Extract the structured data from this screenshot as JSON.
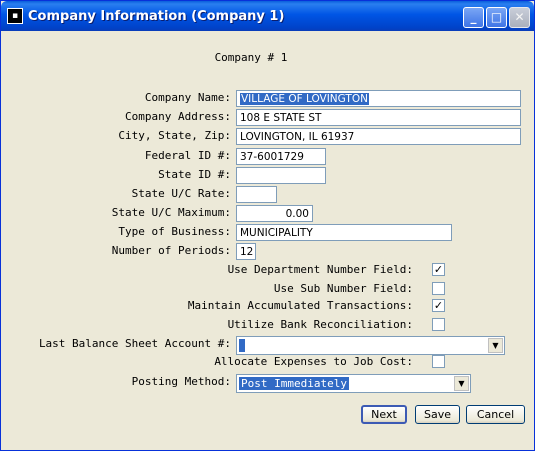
{
  "window": {
    "title": "Company Information (Company 1)",
    "app_icon": "app-icon",
    "controls": {
      "minimize": "_",
      "maximize": "□",
      "close": "✕"
    }
  },
  "form": {
    "heading": "Company # 1",
    "company_name": {
      "label": "Company Name:",
      "value": "VILLAGE OF LOVINGTON"
    },
    "company_address": {
      "label": "Company Address:",
      "value": "108 E STATE ST"
    },
    "city_state_zip": {
      "label": "City, State, Zip:",
      "value": "LOVINGTON, IL 61937"
    },
    "federal_id": {
      "label": "Federal ID #:",
      "value": "37-6001729"
    },
    "state_id": {
      "label": "State ID #:",
      "value": ""
    },
    "state_uc_rate": {
      "label": "State U/C Rate:",
      "value": ""
    },
    "state_uc_max": {
      "label": "State U/C Maximum:",
      "value": "0.00"
    },
    "type_of_business": {
      "label": "Type of Business:",
      "value": "MUNICIPALITY"
    },
    "number_of_periods": {
      "label": "Number of Periods:",
      "value": "12"
    },
    "use_department": {
      "label": "Use Department Number Field:",
      "checked": true
    },
    "use_sub_number": {
      "label": "Use Sub Number Field:",
      "checked": false
    },
    "maintain_accumulated": {
      "label": "Maintain Accumulated Transactions:",
      "checked": true
    },
    "bank_reconciliation": {
      "label": "Utilize Bank Reconciliation:",
      "checked": false
    },
    "last_balance_sheet": {
      "label": "Last Balance Sheet Account #:",
      "value": ""
    },
    "allocate_expenses": {
      "label": "Allocate Expenses to Job Cost:",
      "checked": false
    },
    "posting_method": {
      "label": "Posting Method:",
      "value": "Post Immediately"
    }
  },
  "buttons": {
    "next": "Next",
    "save": "Save",
    "cancel": "Cancel"
  },
  "check_mark": "✓",
  "dropdown_arrow": "▼"
}
